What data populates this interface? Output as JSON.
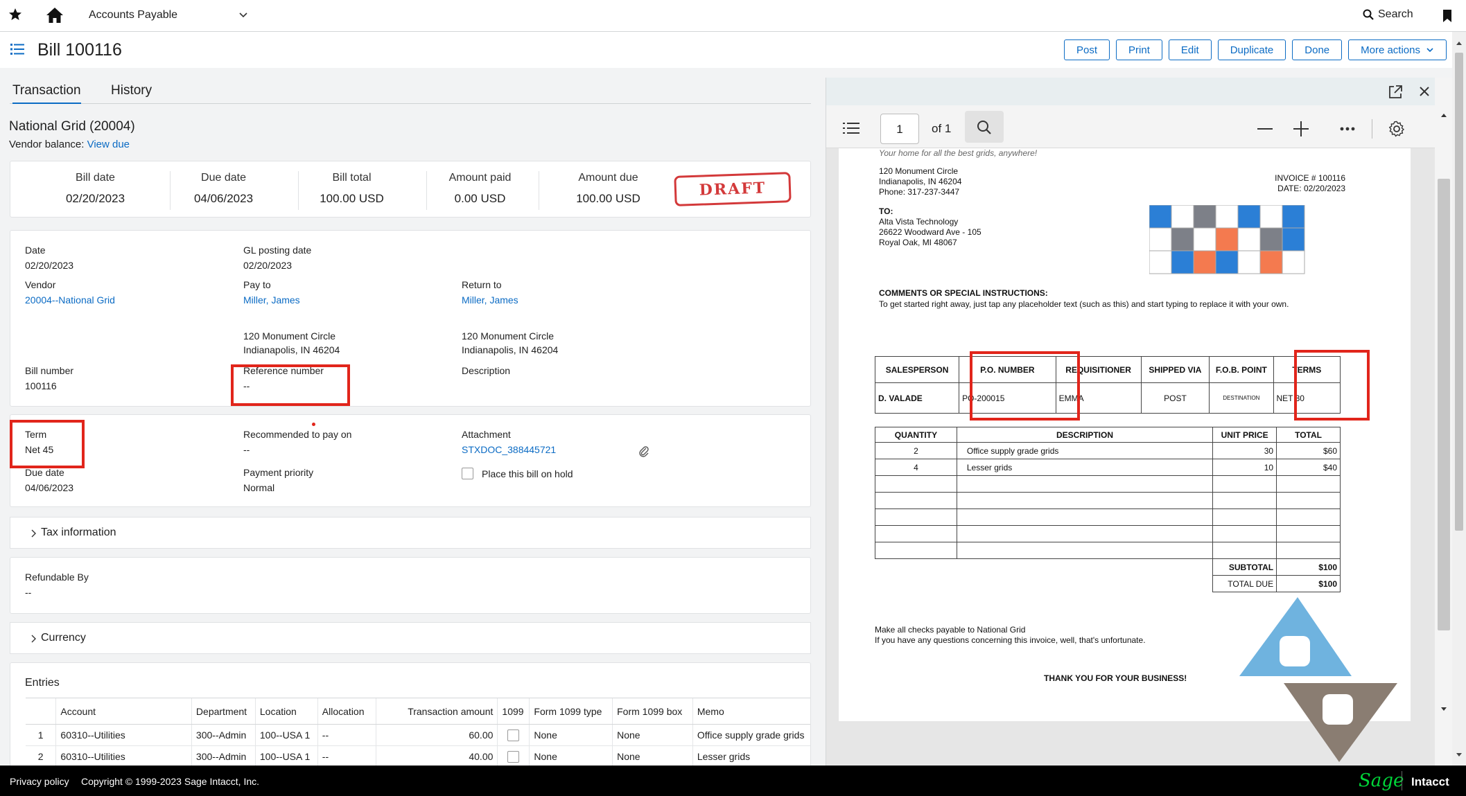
{
  "topbar": {
    "module": "Accounts Payable",
    "search_label": "Search"
  },
  "header": {
    "title": "Bill 100116",
    "actions": [
      "Post",
      "Print",
      "Edit",
      "Duplicate",
      "Done"
    ],
    "more_actions": "More actions"
  },
  "tabs": [
    "Transaction",
    "History"
  ],
  "vendor": {
    "name": "National Grid (20004)",
    "balance_label": "Vendor balance:",
    "balance_link": "View due"
  },
  "summary": [
    {
      "label": "Bill date",
      "value": "02/20/2023"
    },
    {
      "label": "Due date",
      "value": "04/06/2023"
    },
    {
      "label": "Bill total",
      "value": "100.00 USD"
    },
    {
      "label": "Amount paid",
      "value": "0.00 USD"
    },
    {
      "label": "Amount due",
      "value": "100.00 USD"
    }
  ],
  "stamp": "DRAFT",
  "details": {
    "date": {
      "label": "Date",
      "value": "02/20/2023"
    },
    "gl_posting": {
      "label": "GL posting date",
      "value": "02/20/2023"
    },
    "vendor": {
      "label": "Vendor",
      "value": "20004--National Grid"
    },
    "pay_to": {
      "label": "Pay to",
      "value": "Miller, James",
      "addr1": "120 Monument Circle",
      "addr2": "Indianapolis, IN 46204"
    },
    "return_to": {
      "label": "Return to",
      "value": "Miller, James",
      "addr1": "120 Monument Circle",
      "addr2": "Indianapolis, IN 46204"
    },
    "bill_number": {
      "label": "Bill number",
      "value": "100116"
    },
    "reference": {
      "label": "Reference number",
      "value": "--"
    },
    "description": {
      "label": "Description"
    }
  },
  "terms": {
    "term": {
      "label": "Term",
      "value": "Net 45"
    },
    "due": {
      "label": "Due date",
      "value": "04/06/2023"
    },
    "recommended": {
      "label": "Recommended to pay on",
      "value": "--"
    },
    "priority": {
      "label": "Payment priority",
      "value": "Normal"
    },
    "attachment": {
      "label": "Attachment",
      "value": "STXDOC_388445721"
    },
    "hold_label": "Place this bill on hold"
  },
  "sections": {
    "tax": "Tax information",
    "refundable_label": "Refundable By",
    "refundable_value": "--",
    "currency": "Currency"
  },
  "entries": {
    "title": "Entries",
    "headers": [
      "Account",
      "Department",
      "Location",
      "Allocation",
      "Transaction amount",
      "1099",
      "Form 1099 type",
      "Form 1099 box",
      "Memo"
    ],
    "rows": [
      {
        "n": "1",
        "account": "60310--Utilities",
        "dept": "300--Admin",
        "loc": "100--USA 1",
        "alloc": "--",
        "amount": "60.00",
        "type": "None",
        "box": "None",
        "memo": "Office supply grade grids"
      },
      {
        "n": "2",
        "account": "60310--Utilities",
        "dept": "300--Admin",
        "loc": "100--USA 1",
        "alloc": "--",
        "amount": "40.00",
        "type": "None",
        "box": "None",
        "memo": "Lesser grids"
      }
    ]
  },
  "viewer": {
    "page": "1",
    "of": "of 1"
  },
  "invoice": {
    "tagline": "Your home for all the best grids, anywhere!",
    "from": [
      "120 Monument Circle",
      "Indianapolis, IN 46204",
      "Phone: 317-237-3447"
    ],
    "invoice_no": "INVOICE # 100116",
    "invoice_date": "DATE: 02/20/2023",
    "to_label": "TO:",
    "to": [
      "Alta Vista Technology",
      "26622 Woodward Ave - 105",
      "Royal Oak, MI 48067"
    ],
    "comments_title": "COMMENTS OR SPECIAL INSTRUCTIONS:",
    "comments": "To get started right away, just tap any placeholder text (such as this) and start typing to replace it with your own.",
    "meta_headers": [
      "SALESPERSON",
      "P.O. NUMBER",
      "REQUISITIONER",
      "SHIPPED VIA",
      "F.O.B. POINT",
      "TERMS"
    ],
    "meta_values": [
      "D. VALADE",
      "PO-200015",
      "EMMA",
      "POST",
      "DESTINATION",
      "NET 30"
    ],
    "item_headers": [
      "QUANTITY",
      "DESCRIPTION",
      "UNIT PRICE",
      "TOTAL"
    ],
    "items": [
      {
        "qty": "2",
        "desc": "Office supply grade grids",
        "price": "30",
        "total": "$60"
      },
      {
        "qty": "4",
        "desc": "Lesser grids",
        "price": "10",
        "total": "$40"
      }
    ],
    "subtotal_label": "SUBTOTAL",
    "subtotal": "$100",
    "total_label": "TOTAL DUE",
    "total": "$100",
    "payable": "Make all checks payable to National Grid",
    "questions": "If you have any questions concerning this invoice, well, that's unfortunate.",
    "thanks": "THANK YOU FOR YOUR BUSINESS!"
  },
  "footer": {
    "privacy": "Privacy policy",
    "copyright": "Copyright © 1999-2023 Sage Intacct, Inc.",
    "brand": "Sage",
    "product": "Intacct"
  },
  "colors": {
    "accent": "#0b6bc4",
    "highlight": "#e1251b",
    "brand": "#00d639"
  }
}
